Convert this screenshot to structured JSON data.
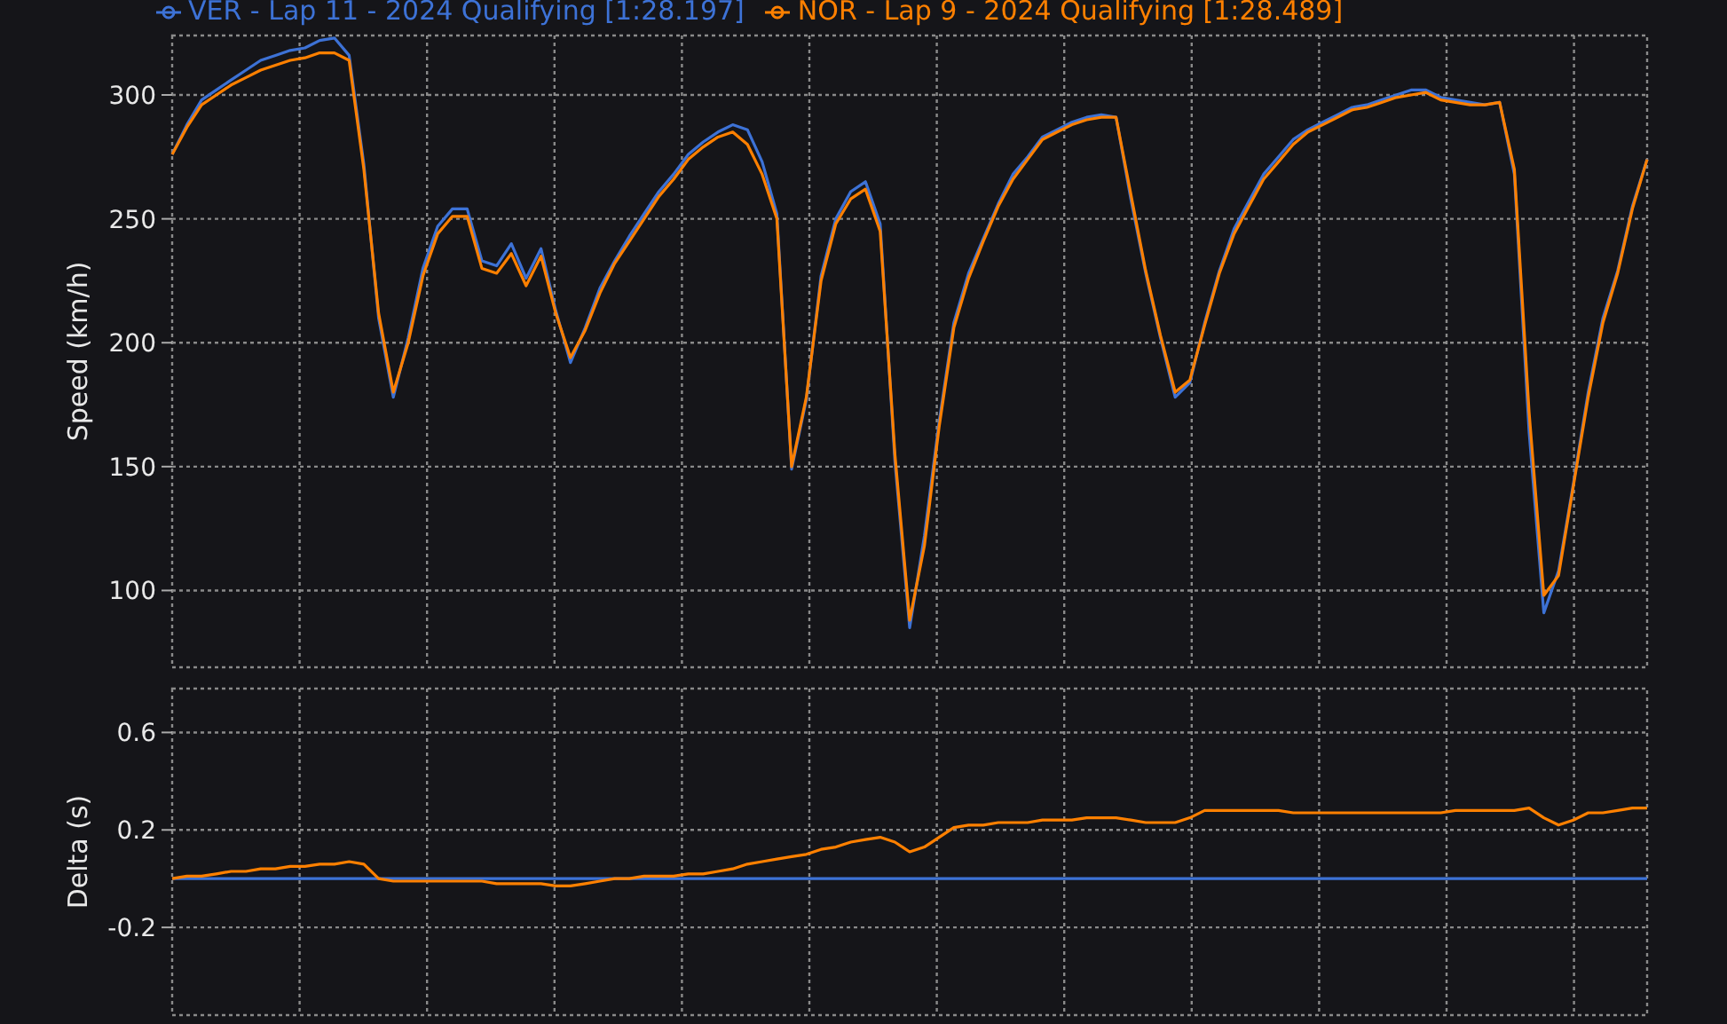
{
  "speed_panel": {
    "chart_data": {
      "type": "line",
      "grid": true,
      "ylabel": "Speed (km/h)",
      "ylim": [
        69,
        324
      ],
      "yticks": [
        100,
        150,
        200,
        250,
        300
      ],
      "categories": [
        null,
        null,
        null,
        null,
        null,
        null,
        null,
        null,
        null,
        null,
        null,
        null,
        null,
        null,
        null,
        null,
        null,
        null,
        null,
        null,
        null,
        null,
        null,
        null,
        null,
        null,
        null,
        null,
        null,
        null,
        null,
        null,
        null,
        null,
        null,
        null,
        null,
        null,
        null,
        null,
        null,
        null,
        null,
        null,
        null,
        null,
        null,
        null,
        null,
        null,
        null,
        null,
        null,
        null,
        null,
        null,
        null,
        null,
        null,
        null,
        null,
        null,
        null,
        null,
        null,
        null,
        null,
        null,
        null,
        null,
        null,
        null,
        null,
        null,
        null,
        null,
        null,
        null,
        null,
        null,
        null,
        null,
        null,
        null,
        null,
        null,
        null,
        null,
        null,
        null,
        null,
        null,
        null,
        null,
        null,
        null,
        null,
        null,
        null,
        null,
        null
      ],
      "series": [
        {
          "name": "VER - Lap 11 - 2024 Qualifying [1:28.197]",
          "color": "#3d72d6",
          "values": [
            276,
            288,
            298,
            302,
            306,
            310,
            314,
            316,
            318,
            319,
            322,
            323,
            316,
            272,
            210,
            178,
            202,
            230,
            247,
            254,
            254,
            233,
            231,
            240,
            226,
            238,
            213,
            192,
            206,
            222,
            233,
            243,
            252,
            261,
            268,
            276,
            281,
            285,
            288,
            286,
            273,
            252,
            149,
            177,
            227,
            250,
            261,
            265,
            248,
            152,
            85,
            122,
            168,
            208,
            228,
            242,
            256,
            268,
            275,
            283,
            286,
            289,
            291,
            292,
            291,
            258,
            228,
            202,
            178,
            184,
            208,
            229,
            246,
            257,
            268,
            275,
            282,
            286,
            289,
            292,
            295,
            296,
            298,
            300,
            302,
            302,
            299,
            298,
            297,
            296,
            297,
            268,
            164,
            91,
            108,
            143,
            180,
            210,
            229,
            255,
            274
          ]
        },
        {
          "name": "NOR - Lap 9 - 2024 Qualifying [1:28.489]",
          "color": "#ff8000",
          "values": [
            276,
            287,
            296,
            300,
            304,
            307,
            310,
            312,
            314,
            315,
            317,
            317,
            314,
            270,
            212,
            180,
            200,
            227,
            244,
            251,
            251,
            230,
            228,
            236,
            223,
            235,
            212,
            194,
            205,
            220,
            232,
            241,
            250,
            259,
            266,
            274,
            279,
            283,
            285,
            280,
            268,
            250,
            150,
            178,
            225,
            248,
            258,
            262,
            245,
            155,
            88,
            118,
            166,
            206,
            226,
            241,
            255,
            266,
            274,
            282,
            285,
            288,
            290,
            291,
            291,
            260,
            229,
            203,
            180,
            185,
            207,
            228,
            244,
            255,
            266,
            273,
            280,
            285,
            288,
            291,
            294,
            295,
            297,
            299,
            300,
            301,
            298,
            297,
            296,
            296,
            297,
            270,
            172,
            98,
            106,
            142,
            178,
            208,
            228,
            254,
            274
          ]
        }
      ]
    }
  },
  "delta_panel": {
    "chart_data": {
      "type": "line",
      "grid": true,
      "ylabel": "Delta (s)",
      "ylim": [
        -0.56,
        0.78
      ],
      "yticks": [
        0.6,
        0.2,
        -0.2
      ],
      "categories": [
        null,
        null,
        null,
        null,
        null,
        null,
        null,
        null,
        null,
        null,
        null,
        null,
        null,
        null,
        null,
        null,
        null,
        null,
        null,
        null,
        null,
        null,
        null,
        null,
        null,
        null,
        null,
        null,
        null,
        null,
        null,
        null,
        null,
        null,
        null,
        null,
        null,
        null,
        null,
        null,
        null,
        null,
        null,
        null,
        null,
        null,
        null,
        null,
        null,
        null,
        null,
        null,
        null,
        null,
        null,
        null,
        null,
        null,
        null,
        null,
        null,
        null,
        null,
        null,
        null,
        null,
        null,
        null,
        null,
        null,
        null,
        null,
        null,
        null,
        null,
        null,
        null,
        null,
        null,
        null,
        null,
        null,
        null,
        null,
        null,
        null,
        null,
        null,
        null,
        null,
        null,
        null,
        null,
        null,
        null,
        null,
        null,
        null,
        null,
        null,
        null
      ],
      "series": [
        {
          "color": "#3d72d6",
          "values": [
            0,
            0,
            0,
            0,
            0,
            0,
            0,
            0,
            0,
            0,
            0,
            0,
            0,
            0,
            0,
            0,
            0,
            0,
            0,
            0,
            0,
            0,
            0,
            0,
            0,
            0,
            0,
            0,
            0,
            0,
            0,
            0,
            0,
            0,
            0,
            0,
            0,
            0,
            0,
            0,
            0,
            0,
            0,
            0,
            0,
            0,
            0,
            0,
            0,
            0,
            0,
            0,
            0,
            0,
            0,
            0,
            0,
            0,
            0,
            0,
            0,
            0,
            0,
            0,
            0,
            0,
            0,
            0,
            0,
            0,
            0,
            0,
            0,
            0,
            0,
            0,
            0,
            0,
            0,
            0,
            0,
            0,
            0,
            0,
            0,
            0,
            0,
            0,
            0,
            0,
            0,
            0,
            0,
            0,
            0,
            0,
            0,
            0,
            0,
            0,
            0
          ]
        },
        {
          "color": "#ff8000",
          "values": [
            0,
            0.01,
            0.01,
            0.02,
            0.03,
            0.03,
            0.04,
            0.04,
            0.05,
            0.05,
            0.06,
            0.06,
            0.07,
            0.06,
            0,
            -0.01,
            -0.01,
            -0.01,
            -0.01,
            -0.01,
            -0.01,
            -0.01,
            -0.02,
            -0.02,
            -0.02,
            -0.02,
            -0.03,
            -0.03,
            -0.02,
            -0.01,
            0,
            0,
            0.01,
            0.01,
            0.01,
            0.02,
            0.02,
            0.03,
            0.04,
            0.06,
            0.07,
            0.08,
            0.09,
            0.1,
            0.12,
            0.13,
            0.15,
            0.16,
            0.17,
            0.15,
            0.11,
            0.13,
            0.17,
            0.21,
            0.22,
            0.22,
            0.23,
            0.23,
            0.23,
            0.24,
            0.24,
            0.24,
            0.25,
            0.25,
            0.25,
            0.24,
            0.23,
            0.23,
            0.23,
            0.25,
            0.28,
            0.28,
            0.28,
            0.28,
            0.28,
            0.28,
            0.27,
            0.27,
            0.27,
            0.27,
            0.27,
            0.27,
            0.27,
            0.27,
            0.27,
            0.27,
            0.27,
            0.28,
            0.28,
            0.28,
            0.28,
            0.28,
            0.29,
            0.25,
            0.22,
            0.24,
            0.27,
            0.27,
            0.28,
            0.29,
            0.29
          ]
        }
      ]
    }
  }
}
